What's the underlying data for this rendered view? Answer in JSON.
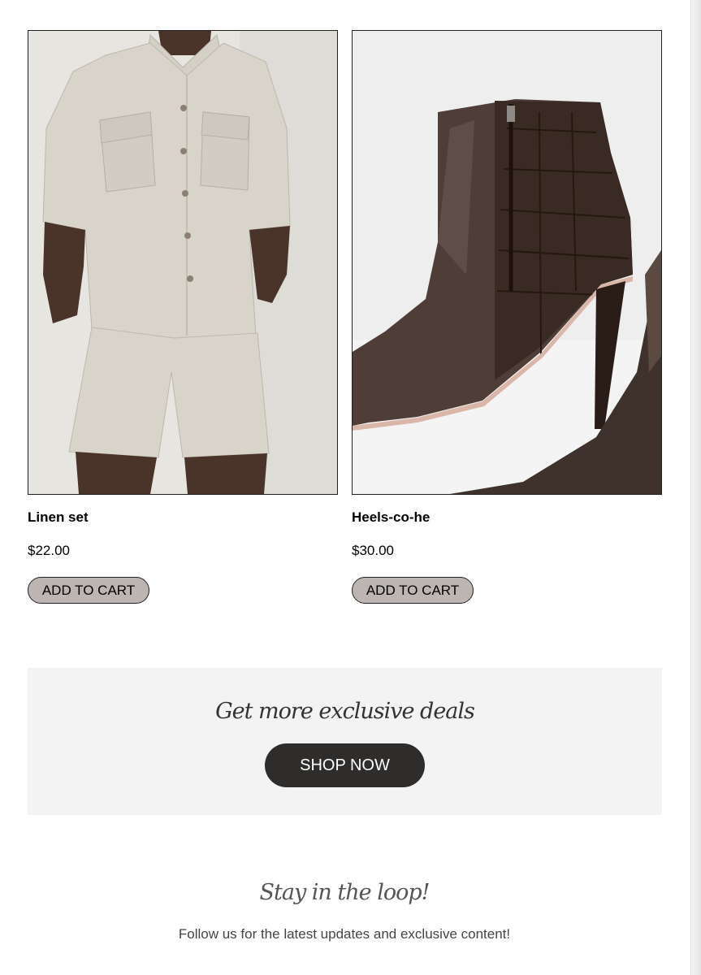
{
  "products": [
    {
      "name": "Linen set",
      "price": "$22.00",
      "cart_label": "ADD TO CART",
      "image": "beige linen shirt and shorts outfit"
    },
    {
      "name": "Heels-co-he",
      "price": "$30.00",
      "cart_label": "ADD TO CART",
      "image": "dark brown leather stiletto ankle boot"
    }
  ],
  "promo": {
    "title": "Get more exclusive deals",
    "button_label": "SHOP NOW"
  },
  "social": {
    "title": "Stay in the loop!",
    "subtitle": "Follow us for the latest updates and exclusive content!"
  },
  "colors": {
    "cart_button_bg": "#bdb5b2",
    "shop_button_bg": "#2f2d2c",
    "promo_bg": "#f3f3f3"
  }
}
